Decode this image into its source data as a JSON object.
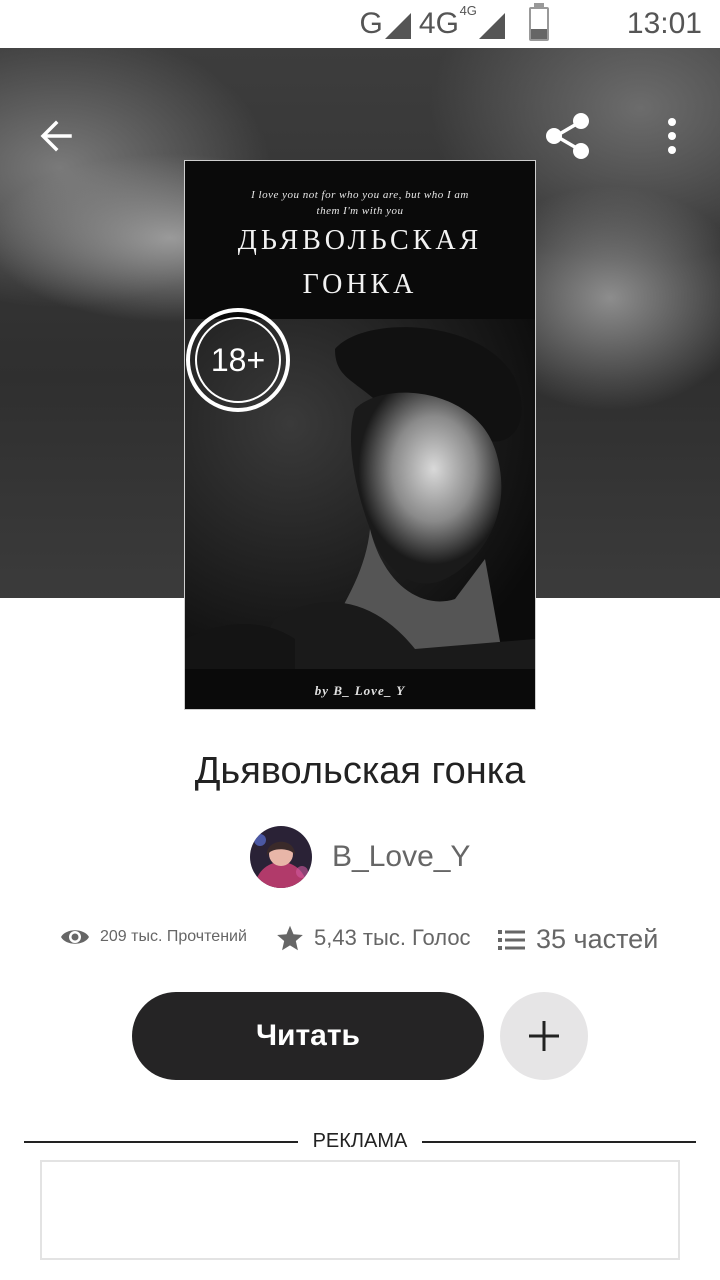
{
  "status_bar": {
    "network_1": "G",
    "network_2": "4G",
    "network_2_small": "4G",
    "time": "13:01",
    "battery_level": 0.35
  },
  "top_bar": {
    "back_icon": "arrow-left-icon",
    "share_icon": "share-icon",
    "more_icon": "more-vertical-icon"
  },
  "cover": {
    "quote_line1": "I love you not for who you are, but who I am",
    "quote_line2": "them I'm with you",
    "title_line1": "ДЬЯВОЛЬСКАЯ",
    "title_line2": "ГОНКА",
    "byline": "by B_ Love_ Y",
    "age_badge": "18+"
  },
  "story": {
    "title": "Дьявольская гонка",
    "author": "B_Love_Y"
  },
  "stats": {
    "reads": "209 тыс. Прочтений",
    "votes": "5,43 тыс. Голос",
    "parts": "35 частей",
    "reads_icon": "eye-icon",
    "votes_icon": "star-icon",
    "parts_icon": "list-icon"
  },
  "actions": {
    "read_label": "Читать",
    "add_icon": "plus-icon"
  },
  "ad": {
    "label": "РЕКЛАМА"
  },
  "colors": {
    "primary_button": "#252425",
    "secondary_button": "#e6e5e6"
  }
}
